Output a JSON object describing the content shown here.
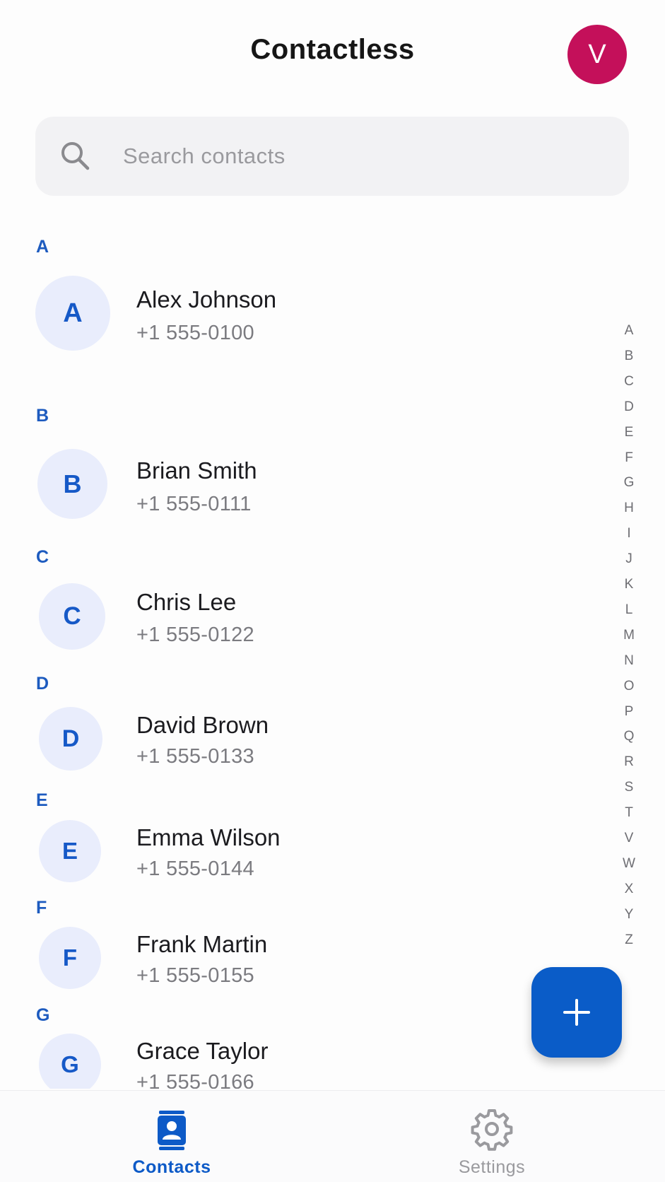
{
  "app": {
    "title": "Contactless",
    "user_avatar_initial": "V",
    "colors": {
      "accent": "#0a5cc8",
      "avatar": "#c4105a",
      "section_letter": "#1d5bbf",
      "contact_avatar_bg": "#e9edfc"
    }
  },
  "search": {
    "placeholder": "Search contacts",
    "icon": "search-icon"
  },
  "sections": [
    {
      "letter": "A",
      "contacts": [
        {
          "initial": "A",
          "name": "Alex Johnson",
          "phone": "+1 555-0100"
        }
      ]
    },
    {
      "letter": "B",
      "contacts": [
        {
          "initial": "B",
          "name": "Brian Smith",
          "phone": "+1 555-0111"
        }
      ]
    },
    {
      "letter": "C",
      "contacts": [
        {
          "initial": "C",
          "name": "Chris Lee",
          "phone": "+1 555-0122"
        }
      ]
    },
    {
      "letter": "D",
      "contacts": [
        {
          "initial": "D",
          "name": "David Brown",
          "phone": "+1 555-0133"
        }
      ]
    },
    {
      "letter": "E",
      "contacts": [
        {
          "initial": "E",
          "name": "Emma Wilson",
          "phone": "+1 555-0144"
        }
      ]
    },
    {
      "letter": "F",
      "contacts": [
        {
          "initial": "F",
          "name": "Frank Martin",
          "phone": "+1 555-0155"
        }
      ]
    },
    {
      "letter": "G",
      "contacts": [
        {
          "initial": "G",
          "name": "Grace Taylor",
          "phone": "+1 555-0166"
        }
      ]
    }
  ],
  "alphabet_index": [
    "A",
    "B",
    "C",
    "D",
    "E",
    "F",
    "G",
    "H",
    "I",
    "J",
    "K",
    "L",
    "M",
    "N",
    "O",
    "P",
    "Q",
    "R",
    "S",
    "T",
    "V",
    "W",
    "X",
    "Y",
    "Z"
  ],
  "fab": {
    "icon": "plus-icon"
  },
  "bottom_nav": {
    "contacts_label": "Contacts",
    "contacts_icon": "contact-card-icon",
    "settings_label": "Settings",
    "settings_icon": "gear-icon"
  }
}
